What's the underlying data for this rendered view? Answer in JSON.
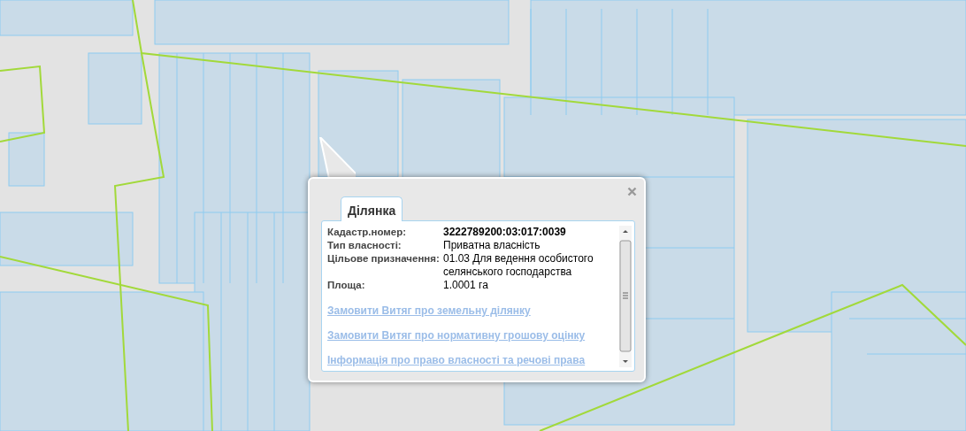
{
  "popup": {
    "tabs": [
      {
        "label": "Ділянка",
        "selected": true
      }
    ],
    "fields": [
      {
        "label": "Кадастр.номер:",
        "value": "3222789200:03:017:0039",
        "bold": true
      },
      {
        "label": "Тип власності:",
        "value": "Приватна власність",
        "bold": false
      },
      {
        "label": "Цільове призначення:",
        "value": "01.03 Для ведення особистого селянського господарства",
        "bold": false
      },
      {
        "label": "Площа:",
        "value": "1.0001 га",
        "bold": false
      }
    ],
    "links": [
      "Замовити Витяг про земельну ділянку",
      "Замовити Витяг про нормативну грошову оцінку",
      "Інформація про право власності та речові права"
    ]
  }
}
